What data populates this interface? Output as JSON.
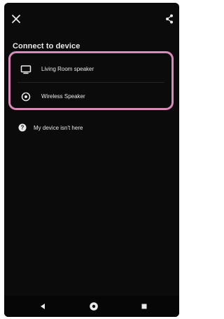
{
  "header": {
    "close_icon": "close-icon",
    "share_icon": "share-icon",
    "title": "Connect to device"
  },
  "devices": [
    {
      "label": "Living Room speaker",
      "icon": "tv-icon"
    },
    {
      "label": "Wireless Speaker",
      "icon": "speaker-icon"
    }
  ],
  "help": {
    "label": "My device isn't here",
    "icon": "help-icon"
  },
  "navigation": {
    "back_icon": "back-icon",
    "home_icon": "home-icon",
    "recent_icon": "recent-apps-icon"
  },
  "colors": {
    "background": "#0b0b0b",
    "text": "#e9e9e9",
    "highlight": "#d98ab8"
  }
}
